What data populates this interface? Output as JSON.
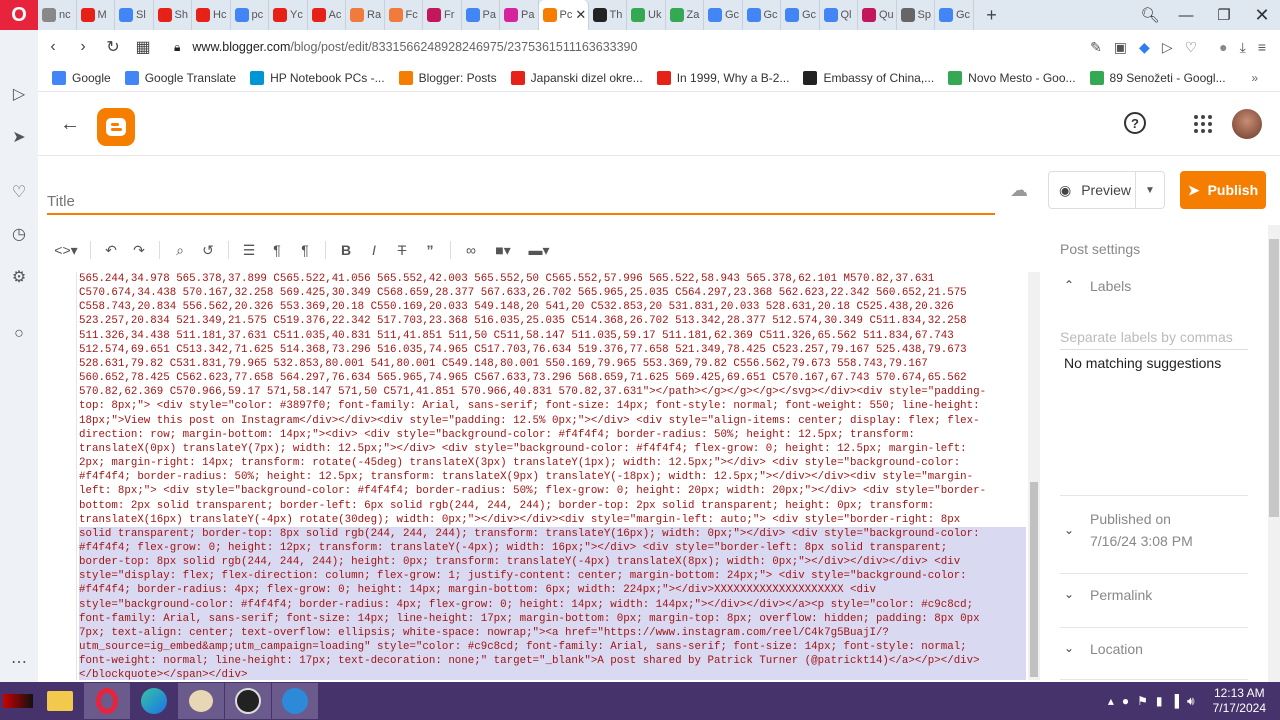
{
  "browser": {
    "tabs": [
      {
        "label": "nc",
        "icon": "nc-icon",
        "color": "#888"
      },
      {
        "label": "M",
        "icon": "youtube-icon",
        "color": "#e62117"
      },
      {
        "label": "Sl",
        "icon": "google-icon",
        "color": "#4285f4"
      },
      {
        "label": "Sh",
        "icon": "youtube-icon",
        "color": "#e62117"
      },
      {
        "label": "Hc",
        "icon": "youtube-icon",
        "color": "#e62117"
      },
      {
        "label": "pc",
        "icon": "google-icon",
        "color": "#4285f4"
      },
      {
        "label": "Yc",
        "icon": "youtube-icon",
        "color": "#e62117"
      },
      {
        "label": "Ac",
        "icon": "youtube-icon",
        "color": "#e62117"
      },
      {
        "label": "Ra",
        "icon": "ra-icon",
        "color": "#f07b3c"
      },
      {
        "label": "Fc",
        "icon": "fc-icon",
        "color": "#f07b3c"
      },
      {
        "label": "Fr",
        "icon": "fr-icon",
        "color": "#c2185b"
      },
      {
        "label": "Pa",
        "icon": "google-icon",
        "color": "#4285f4"
      },
      {
        "label": "Pa",
        "icon": "instagram-icon",
        "color": "#d6249f"
      },
      {
        "label": "Pc",
        "icon": "blogger-icon",
        "color": "#f57d00",
        "active": true
      },
      {
        "label": "Th",
        "icon": "nyt-icon",
        "color": "#222"
      },
      {
        "label": "Uk",
        "icon": "maps-icon",
        "color": "#34a853"
      },
      {
        "label": "Za",
        "icon": "maps-icon",
        "color": "#34a853"
      },
      {
        "label": "Gc",
        "icon": "translate-icon",
        "color": "#4285f4"
      },
      {
        "label": "Gc",
        "icon": "translate-icon",
        "color": "#4285f4"
      },
      {
        "label": "Gc",
        "icon": "translate-icon",
        "color": "#4285f4"
      },
      {
        "label": "Ql",
        "icon": "google-icon",
        "color": "#4285f4"
      },
      {
        "label": "Qu",
        "icon": "us-icon",
        "color": "#c2185b"
      },
      {
        "label": "Sp",
        "icon": "grid-icon",
        "color": "#666"
      },
      {
        "label": "Gc",
        "icon": "translate-icon",
        "color": "#4285f4"
      }
    ],
    "url_domain": "www.blogger.com",
    "url_path": "/blog/post/edit/8331566248928246975/2375361511163633390",
    "bookmarks": [
      {
        "label": "Google",
        "icon": "google-icon",
        "color": "#4285f4"
      },
      {
        "label": "Google Translate",
        "icon": "translate-icon",
        "color": "#4285f4"
      },
      {
        "label": "HP Notebook PCs -...",
        "icon": "hp-icon",
        "color": "#0096d6"
      },
      {
        "label": "Blogger: Posts",
        "icon": "blogger-icon",
        "color": "#f57d00"
      },
      {
        "label": "Japanski dizel okre...",
        "icon": "youtube-icon",
        "color": "#e62117"
      },
      {
        "label": "In 1999, Why a B-2...",
        "icon": "youtube-icon",
        "color": "#e62117"
      },
      {
        "label": "Embassy of China,...",
        "icon": "wikipedia-icon",
        "color": "#222"
      },
      {
        "label": "Novo Mesto - Goo...",
        "icon": "maps-icon",
        "color": "#34a853"
      },
      {
        "label": "89 Senožeti - Googl...",
        "icon": "maps-icon",
        "color": "#34a853"
      }
    ]
  },
  "editor": {
    "title_placeholder": "Title",
    "preview_label": "Preview",
    "publish_label": "Publish",
    "accent_color": "#f57d00",
    "code_lines": [
      "565.244,34.978 565.378,37.899 C565.522,41.056 565.552,42.003 565.552,50 C565.552,57.996 565.522,58.943 565.378,62.101 M570.82,37.631",
      "C570.674,34.438 570.167,32.258 569.425,30.349 C568.659,28.377 567.633,26.702 565.965,25.035 C564.297,23.368 562.623,22.342 560.652,21.575",
      "C558.743,20.834 556.562,20.326 553.369,20.18 C550.169,20.033 549.148,20 541,20 C532.853,20 531.831,20.033 528.631,20.18 C525.438,20.326",
      "523.257,20.834 521.349,21.575 C519.376,22.342 517.703,23.368 516.035,25.035 C514.368,26.702 513.342,28.377 512.574,30.349 C511.834,32.258",
      "511.326,34.438 511.181,37.631 C511.035,40.831 511,41.851 511,50 C511,58.147 511.035,59.17 511.181,62.369 C511.326,65.562 511.834,67.743",
      "512.574,69.651 C513.342,71.625 514.368,73.296 516.035,74.965 C517.703,76.634 519.376,77.658 521.349,78.425 C523.257,79.167 525.438,79.673",
      "528.631,79.82 C531.831,79.965 532.853,80.001 541,80.001 C549.148,80.001 550.169,79.965 553.369,79.82 C556.562,79.673 558.743,79.167",
      "560.652,78.425 C562.623,77.658 564.297,76.634 565.965,74.965 C567.633,73.296 568.659,71.625 569.425,69.651 C570.167,67.743 570.674,65.562",
      "570.82,62.369 C570.966,59.17 571,58.147 571,50 C571,41.851 570.966,40.831 570.82,37.631\"></path></g></g></g></svg></div><div style=\"padding-",
      "top: 8px;\"> <div style=\"color: #3897f0; font-family: Arial, sans-serif; font-size: 14px; font-style: normal; font-weight: 550; line-height:",
      "18px;\">View this post on Instagram</div></div><div style=\"padding: 12.5% 0px;\"></div> <div style=\"align-items: center; display: flex; flex-",
      "direction: row; margin-bottom: 14px;\"><div> <div style=\"background-color: #f4f4f4; border-radius: 50%; height: 12.5px; transform:",
      "translateX(0px) translateY(7px); width: 12.5px;\"></div> <div style=\"background-color: #f4f4f4; flex-grow: 0; height: 12.5px; margin-left:",
      "2px; margin-right: 14px; transform: rotate(-45deg) translateX(3px) translateY(1px); width: 12.5px;\"></div> <div style=\"background-color:",
      "#f4f4f4; border-radius: 50%; height: 12.5px; transform: translateX(9px) translateY(-18px); width: 12.5px;\"></div></div><div style=\"margin-",
      "left: 8px;\"> <div style=\"background-color: #f4f4f4; border-radius: 50%; flex-grow: 0; height: 20px; width: 20px;\"></div> <div style=\"border-",
      "bottom: 2px solid transparent; border-left: 6px solid rgb(244, 244, 244); border-top: 2px solid transparent; height: 0px; transform:",
      "translateX(16px) translateY(-4px) rotate(30deg); width: 0px;\"></div></div><div style=\"margin-left: auto;\"> <div style=\"border-right: 8px",
      "solid transparent; border-top: 8px solid rgb(244, 244, 244); transform: translateY(16px); width: 0px;\"></div> <div style=\"background-color:",
      "#f4f4f4; flex-grow: 0; height: 12px; transform: translateY(-4px); width: 16px;\"></div> <div style=\"border-left: 8px solid transparent;",
      "border-top: 8px solid rgb(244, 244, 244); height: 0px; transform: translateY(-4px) translateX(8px); width: 0px;\"></div></div></div> <div",
      "style=\"display: flex; flex-direction: column; flex-grow: 1; justify-content: center; margin-bottom: 24px;\"> <div style=\"background-color:",
      "#f4f4f4; border-radius: 4px; flex-grow: 0; height: 14px; margin-bottom: 6px; width: 224px;\"></div>XXXXXXXXXXXXXXXXXXXX <div",
      "style=\"background-color: #f4f4f4; border-radius: 4px; flex-grow: 0; height: 14px; width: 144px;\"></div></div></a><p style=\"color: #c9c8cd;",
      "font-family: Arial, sans-serif; font-size: 14px; line-height: 17px; margin-bottom: 0px; margin-top: 8px; overflow: hidden; padding: 8px 0px",
      "7px; text-align: center; text-overflow: ellipsis; white-space: nowrap;\"><a href=\"https://www.instagram.com/reel/C4k7g5BuajI/?",
      "utm_source=ig_embed&amp;utm_campaign=loading\" style=\"color: #c9c8cd; font-family: Arial, sans-serif; font-size: 14px; font-style: normal;",
      "font-weight: normal; line-height: 17px; text-decoration: none;\" target=\"_blank\">A post shared by Patrick Turner (@patrickt14)</a></p></div>",
      "</blockquote></span></div>"
    ]
  },
  "post_settings": {
    "heading": "Post settings",
    "labels_label": "Labels",
    "labels_placeholder": "Separate labels by commas",
    "no_suggestions": "No matching suggestions",
    "published_label": "Published on",
    "published_date": "7/16/24 3:08 PM",
    "permalink_label": "Permalink",
    "location_label": "Location"
  },
  "taskbar": {
    "time": "12:13 AM",
    "date": "7/17/2024"
  }
}
